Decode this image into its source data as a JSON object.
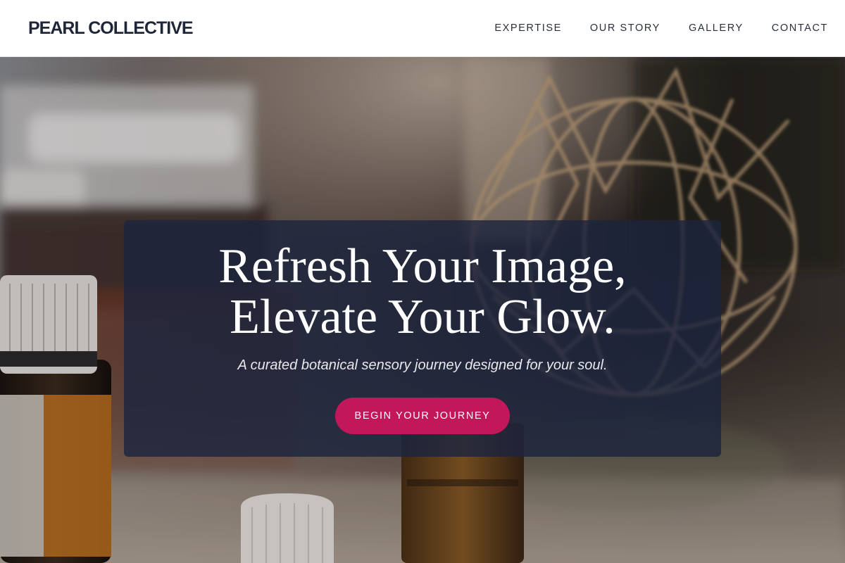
{
  "header": {
    "logo": "PEARL COLLECTIVE",
    "nav": [
      "EXPERTISE",
      "OUR STORY",
      "GALLERY",
      "CONTACT"
    ]
  },
  "hero": {
    "title_line1": "Refresh Your Image,",
    "title_line2": "Elevate Your Glow.",
    "subtitle": "A curated botanical sensory journey designed for your soul.",
    "cta_label": "BEGIN YOUR JOURNEY"
  },
  "colors": {
    "accent": "#c2185b",
    "panel": "#1c253e",
    "logo_text": "#1e2638"
  }
}
